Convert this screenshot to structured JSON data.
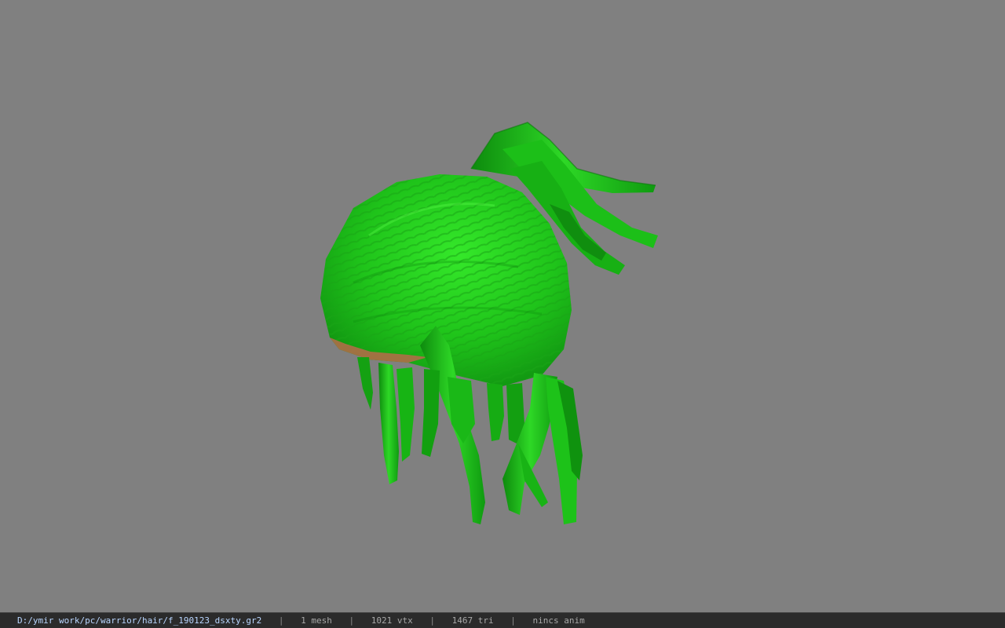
{
  "window": {
    "background_color": "#808080"
  },
  "viewport": {
    "model_icon": "green-hair-mesh",
    "model_color": "#22c41c"
  },
  "statusbar": {
    "path": "D:/ymir work/pc/warrior/hair/f_190123_dsxty.gr2",
    "mesh": "1 mesh",
    "vertices": "1021 vtx",
    "triangles": "1467 tri",
    "anim": "nincs anim",
    "separator": "|"
  }
}
